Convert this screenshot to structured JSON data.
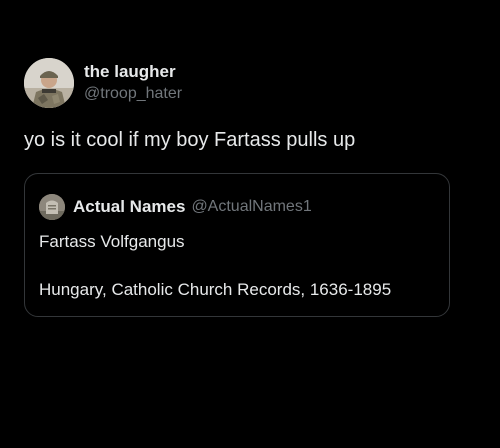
{
  "tweet": {
    "author": {
      "display_name": "the laugher",
      "handle": "@troop_hater",
      "avatar_icon": "soldier-avatar-icon"
    },
    "text": "yo is it cool if my boy Fartass pulls up"
  },
  "quoted_tweet": {
    "author": {
      "display_name": "Actual Names",
      "handle": "@ActualNames1",
      "avatar_icon": "gravestone-avatar-icon"
    },
    "line1": "Fartass Volfgangus",
    "line2": "Hungary, Catholic Church Records, 1636-1895"
  },
  "colors": {
    "background": "#000000",
    "primary_text": "#e7e9ea",
    "secondary_text": "#71767b",
    "border": "#333639"
  }
}
